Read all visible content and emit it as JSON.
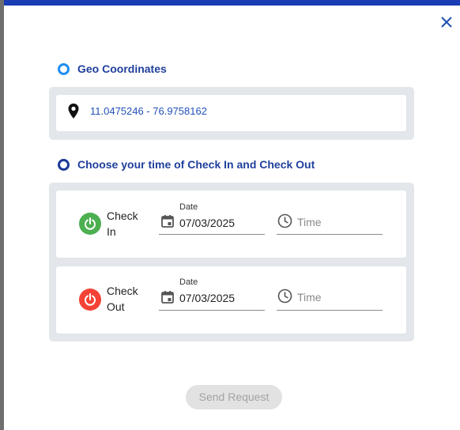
{
  "dialog": {
    "close_label": "✕"
  },
  "geo": {
    "title": "Geo Coordinates",
    "coordinates": "11.0475246 - 76.9758162"
  },
  "timing": {
    "title": "Choose your time of Check In and Check Out",
    "rows": [
      {
        "label_line1": "Check",
        "label_line2": "In",
        "status_color": "#4caf50",
        "date_label": "Date",
        "date_value": "07/03/2025",
        "time_placeholder": "Time"
      },
      {
        "label_line1": "Check",
        "label_line2": "Out",
        "status_color": "#f44336",
        "date_label": "Date",
        "date_value": "07/03/2025",
        "time_placeholder": "Time"
      }
    ]
  },
  "actions": {
    "send_label": "Send Request"
  },
  "colors": {
    "accent": "#1a3db5",
    "title_text": "#1f3f9c",
    "panel_bg": "#e3e7ec"
  },
  "icons": {
    "close": "close-icon",
    "pin": "map-pin-icon",
    "calendar": "calendar-icon",
    "clock": "clock-icon",
    "power": "power-icon"
  }
}
